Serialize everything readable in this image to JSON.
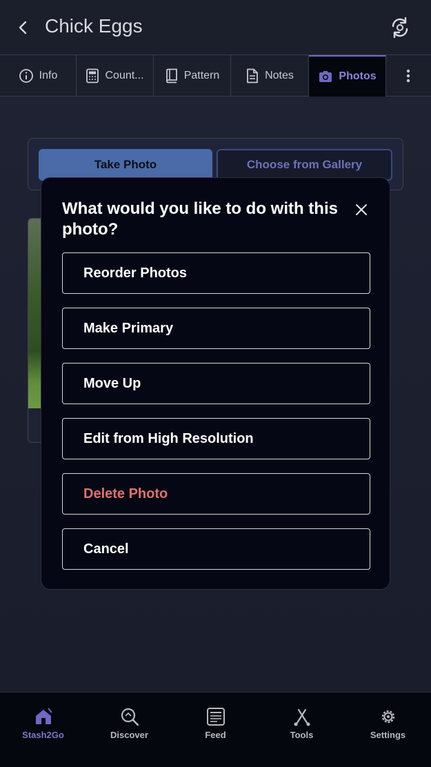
{
  "header": {
    "title": "Chick Eggs"
  },
  "tabs": [
    {
      "label": "Info",
      "icon": "info-icon"
    },
    {
      "label": "Count...",
      "icon": "calculator-icon"
    },
    {
      "label": "Pattern",
      "icon": "book-icon"
    },
    {
      "label": "Notes",
      "icon": "document-icon"
    },
    {
      "label": "Photos",
      "icon": "camera-icon",
      "active": true
    }
  ],
  "photo_actions": {
    "take_photo": "Take Photo",
    "choose_gallery": "Choose from Gallery"
  },
  "modal": {
    "title": "What would you like to do with this photo?",
    "options": [
      "Reorder Photos",
      "Make Primary",
      "Move Up",
      "Edit from High Resolution",
      "Delete Photo",
      "Cancel"
    ]
  },
  "bottom_nav": [
    {
      "label": "Stash2Go",
      "icon": "home-icon",
      "active": true
    },
    {
      "label": "Discover",
      "icon": "discover-search-icon"
    },
    {
      "label": "Feed",
      "icon": "feed-icon"
    },
    {
      "label": "Tools",
      "icon": "tools-icon"
    },
    {
      "label": "Settings",
      "icon": "gear-icon"
    }
  ],
  "colors": {
    "accent": "#7f78c9",
    "primary_button": "#4a6aa8",
    "danger": "#e0706c"
  }
}
